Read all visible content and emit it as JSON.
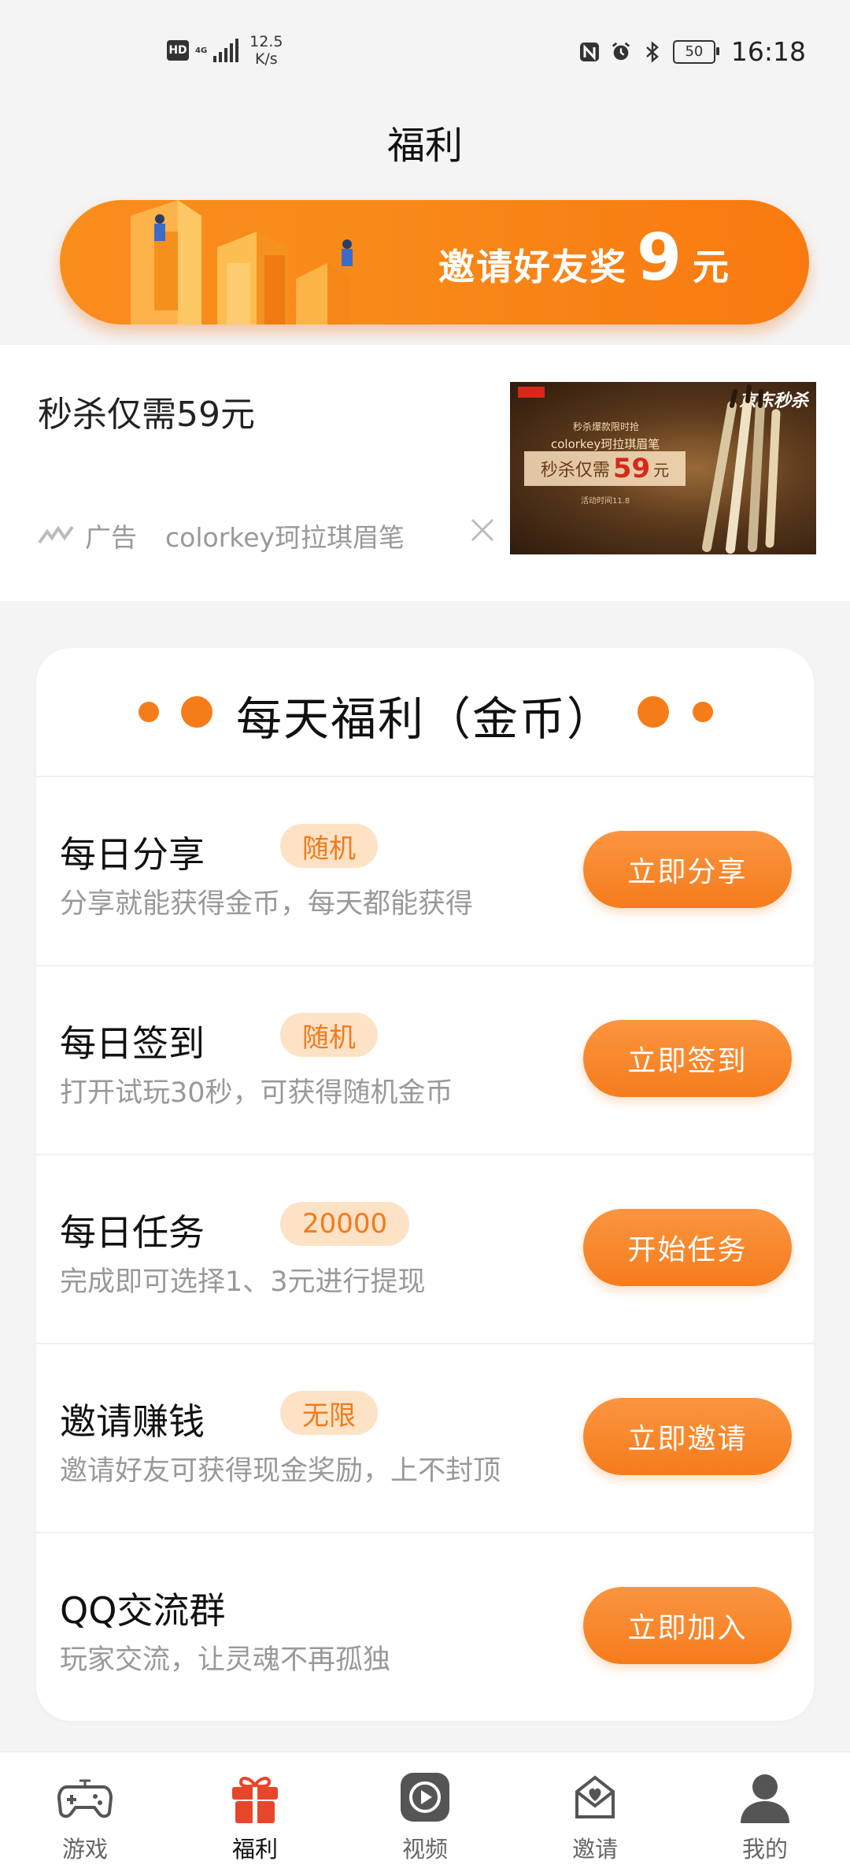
{
  "status_bar": {
    "hd": "HD",
    "network": "4G",
    "speed_value": "12.5",
    "speed_unit": "K/s",
    "battery": "50",
    "time": "16:18"
  },
  "page": {
    "title": "福利"
  },
  "banner": {
    "text": "邀请好友奖",
    "amount": "9",
    "unit": "元"
  },
  "ad": {
    "title": "秒杀仅需59元",
    "label": "广告",
    "product": "colorkey珂拉琪眉笔",
    "image": {
      "brand_tag": "京东秒杀",
      "line1": "秒杀爆款限时抢",
      "line2": "colorkey珂拉琪眉笔",
      "price_prefix": "秒杀仅需",
      "price": "59",
      "price_unit": "元",
      "line3": "活动时间11.8"
    }
  },
  "card": {
    "title": "每天福利（金币）",
    "rows": [
      {
        "title": "每日分享",
        "tag": "随机",
        "desc": "分享就能获得金币，每天都能获得",
        "button": "立即分享"
      },
      {
        "title": "每日签到",
        "tag": "随机",
        "desc": "打开试玩30秒，可获得随机金币",
        "button": "立即签到"
      },
      {
        "title": "每日任务",
        "tag": "20000",
        "desc": "完成即可选择1、3元进行提现",
        "button": "开始任务"
      },
      {
        "title": "邀请赚钱",
        "tag": "无限",
        "desc": "邀请好友可获得现金奖励，上不封顶",
        "button": "立即邀请"
      },
      {
        "title": "QQ交流群",
        "desc": "玩家交流，让灵魂不再孤独",
        "button": "立即加入"
      }
    ]
  },
  "tabs": [
    {
      "label": "游戏",
      "icon": "gamepad-icon"
    },
    {
      "label": "福利",
      "icon": "gift-icon",
      "active": true
    },
    {
      "label": "视频",
      "icon": "video-icon"
    },
    {
      "label": "邀请",
      "icon": "invite-icon"
    },
    {
      "label": "我的",
      "icon": "profile-icon"
    }
  ],
  "colors": {
    "accent": "#f57d19",
    "tag_bg": "#fde2c6",
    "active_tab": "#e8462a"
  }
}
